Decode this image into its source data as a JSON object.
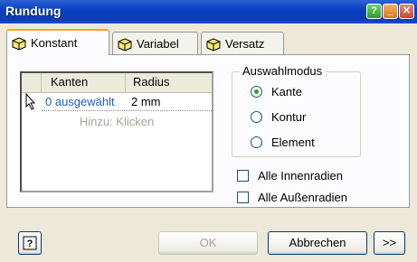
{
  "window": {
    "title": "Rundung"
  },
  "tabs": [
    {
      "label": "Konstant",
      "active": true
    },
    {
      "label": "Variabel",
      "active": false
    },
    {
      "label": "Versatz",
      "active": false
    }
  ],
  "edge_table": {
    "columns": [
      "Kanten",
      "Radius"
    ],
    "rows": [
      {
        "kanten": "0 ausgewählt",
        "radius": "2 mm"
      }
    ],
    "add_hint": "Hinzu: Klicken"
  },
  "selection_mode": {
    "label": "Auswahlmodus",
    "options": [
      {
        "label": "Kante",
        "selected": true
      },
      {
        "label": "Kontur",
        "selected": false
      },
      {
        "label": "Element",
        "selected": false
      }
    ]
  },
  "checkboxes": [
    {
      "label": "Alle Innenradien",
      "checked": false
    },
    {
      "label": "Alle Außenradien",
      "checked": false
    }
  ],
  "buttons": {
    "help": "?",
    "ok": "OK",
    "cancel": "Abbrechen",
    "more": ">>"
  },
  "colors": {
    "titlebar": "#0a3fc2",
    "link": "#1f5dc7",
    "tab_highlight": "#f5a623"
  }
}
